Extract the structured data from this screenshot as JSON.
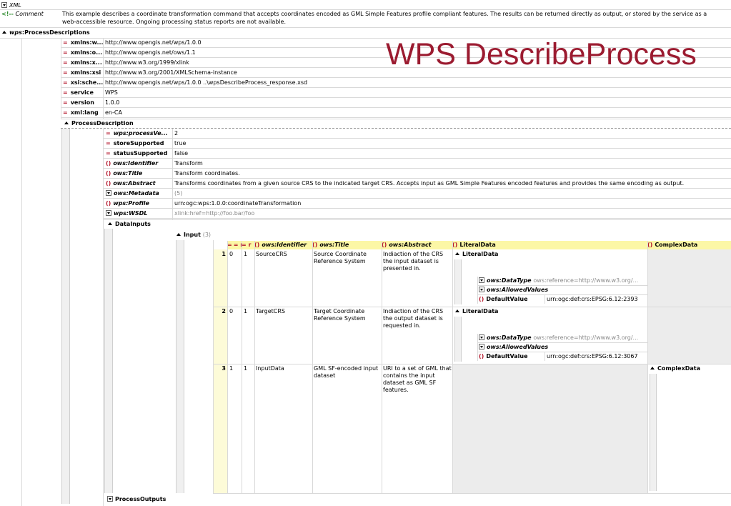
{
  "xml_label": "XML",
  "comment": {
    "label": "Comment",
    "line1": "This example describes a coordinate transformation command that accepts coordinates encoded as GML Simple Features profile compliant features.  The results can be returned directly as output, or stored by the service as a",
    "line2": "web-accessible resource.  Ongoing processing status reports are not available."
  },
  "root": {
    "prefix": "wps",
    "name": ":ProcessDescriptions",
    "attrs": [
      {
        "name": "xmlns:w...",
        "value": "http://www.opengis.net/wps/1.0.0"
      },
      {
        "name": "xmlns:o...",
        "value": "http://www.opengis.net/ows/1.1"
      },
      {
        "name": "xmlns:x...",
        "value": "http://www.w3.org/1999/xlink"
      },
      {
        "name": "xmlns:xsi",
        "value": "http://www.w3.org/2001/XMLSchema-instance"
      },
      {
        "name": "xsi:sche...",
        "value": "http://www.opengis.net/wps/1.0.0 ..\\wpsDescribeProcess_response.xsd"
      },
      {
        "name": "service",
        "value": "WPS"
      },
      {
        "name": "version",
        "value": "1.0.0"
      },
      {
        "name": "xml:lang",
        "value": "en-CA"
      }
    ]
  },
  "overlay_title": "WPS DescribeProcess",
  "process": {
    "name": "ProcessDescription",
    "rows": [
      {
        "kind": "=",
        "name": "wps:processVe...",
        "value": "2"
      },
      {
        "kind": "=",
        "name": "storeSupported",
        "value": "true"
      },
      {
        "kind": "=",
        "name": "statusSupported",
        "value": "false"
      },
      {
        "kind": "()",
        "name": "ows:Identifier",
        "value": "Transform"
      },
      {
        "kind": "()",
        "name": "ows:Title",
        "value": "Transform coordinates."
      },
      {
        "kind": "()",
        "name": "ows:Abstract",
        "value": "Transforms coordinates from a given source CRS to the indicated target CRS. Accepts input as GML Simple Features encoded features and provides the same encoding as output."
      },
      {
        "kind": "v",
        "name": "ows:Metadata",
        "value": "(5)"
      },
      {
        "kind": "()",
        "name": "wps:Profile",
        "value": "urn:ogc:wps:1.0.0:coordinateTransformation"
      },
      {
        "kind": "v",
        "name": "wps:WSDL",
        "value": "xlink:href=http://foo.bar/foo"
      }
    ],
    "datainputs": "DataInputs",
    "input_label": "Input",
    "input_count": "(3)",
    "outputs": "ProcessOutputs"
  },
  "table": {
    "headers": [
      "= r",
      "= r",
      "ows:Identifier",
      "ows:Title",
      "ows:Abstract",
      "LiteralData",
      "ComplexData"
    ],
    "rows": [
      {
        "num": "1",
        "a": "0",
        "b": "1",
        "id": "SourceCRS",
        "title": "Source Coordinate Reference System",
        "abstract": "Indiaction of the CRS the input dataset is presented in.",
        "literal": "LiteralData",
        "datatype": "ows:DataType",
        "datatype_val": "ows:reference=http://www.w3.org/...",
        "allowed": "ows:AllowedValues",
        "default": "DefaultValue",
        "default_val": "urn:ogc:def:crs:EPSG:6.12:2393"
      },
      {
        "num": "2",
        "a": "0",
        "b": "1",
        "id": "TargetCRS",
        "title": "Target Coordinate Reference System",
        "abstract": "Indiaction of the CRS the output dataset is requested in.",
        "literal": "LiteralData",
        "datatype": "ows:DataType",
        "datatype_val": "ows:reference=http://www.w3.org/...",
        "allowed": "ows:AllowedValues",
        "default": "DefaultValue",
        "default_val": "urn:ogc:def:crs:EPSG:6.12:3067"
      },
      {
        "num": "3",
        "a": "1",
        "b": "1",
        "id": "InputData",
        "title": "GML SF-encoded input dataset",
        "abstract": "URI to a set of GML that contains the input dataset as GML SF features.",
        "complex": "ComplexData"
      }
    ]
  },
  "colors": {
    "accent": "#b5172c",
    "title": "#9b1b30",
    "header": "#fcf7a6",
    "rownum": "#fdfbd8",
    "panel": "#ececec"
  }
}
